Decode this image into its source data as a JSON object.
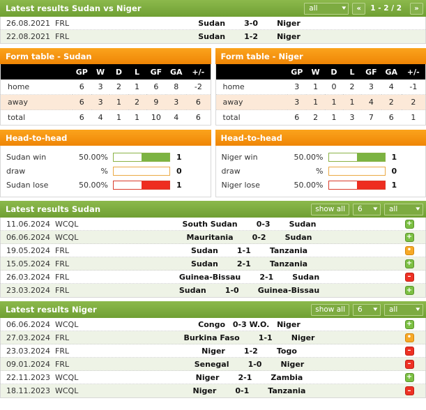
{
  "h2h_results": {
    "header": {
      "title": "Latest results Sudan vs Niger",
      "filter_value": "all",
      "prev_label": "«",
      "next_label": "»",
      "pagination": "1 - 2 / 2"
    },
    "rows": [
      {
        "date": "26.08.2021",
        "competition": "FRL",
        "home": "Sudan",
        "score": "3-0",
        "away": "Niger"
      },
      {
        "date": "22.08.2021",
        "competition": "FRL",
        "home": "Sudan",
        "score": "1-2",
        "away": "Niger"
      }
    ]
  },
  "form_tables": [
    {
      "title": "Form table - Sudan",
      "columns": [
        "",
        "GP",
        "W",
        "D",
        "L",
        "GF",
        "GA",
        "+/-"
      ],
      "rows": [
        {
          "label": "home",
          "gp": "6",
          "w": "3",
          "d": "2",
          "l": "1",
          "gf": "6",
          "ga": "8",
          "diff": "-2"
        },
        {
          "label": "away",
          "gp": "6",
          "w": "3",
          "d": "1",
          "l": "2",
          "gf": "9",
          "ga": "3",
          "diff": "6"
        },
        {
          "label": "total",
          "gp": "6",
          "w": "4",
          "d": "1",
          "l": "1",
          "gf": "10",
          "ga": "4",
          "diff": "6"
        }
      ]
    },
    {
      "title": "Form table - Niger",
      "columns": [
        "",
        "GP",
        "W",
        "D",
        "L",
        "GF",
        "GA",
        "+/-"
      ],
      "rows": [
        {
          "label": "home",
          "gp": "3",
          "w": "1",
          "d": "0",
          "l": "2",
          "gf": "3",
          "ga": "4",
          "diff": "-1"
        },
        {
          "label": "away",
          "gp": "3",
          "w": "1",
          "d": "1",
          "l": "1",
          "gf": "4",
          "ga": "2",
          "diff": "2"
        },
        {
          "label": "total",
          "gp": "6",
          "w": "2",
          "d": "1",
          "l": "3",
          "gf": "7",
          "ga": "6",
          "diff": "1"
        }
      ]
    }
  ],
  "head_to_head": [
    {
      "title": "Head-to-head",
      "rows": [
        {
          "label": "Sudan win",
          "pct": "50.00%",
          "count": "1",
          "fill": 50,
          "color": "green"
        },
        {
          "label": "draw",
          "pct": "%",
          "count": "0",
          "fill": 0,
          "color": "orange"
        },
        {
          "label": "Sudan lose",
          "pct": "50.00%",
          "count": "1",
          "fill": 50,
          "color": "red"
        }
      ]
    },
    {
      "title": "Head-to-head",
      "rows": [
        {
          "label": "Niger win",
          "pct": "50.00%",
          "count": "1",
          "fill": 50,
          "color": "green"
        },
        {
          "label": "draw",
          "pct": "%",
          "count": "0",
          "fill": 0,
          "color": "orange"
        },
        {
          "label": "Niger lose",
          "pct": "50.00%",
          "count": "1",
          "fill": 50,
          "color": "red"
        }
      ]
    }
  ],
  "latest_results": [
    {
      "header": {
        "title": "Latest results Sudan",
        "show_all_label": "show all",
        "count_value": "6",
        "filter_value": "all"
      },
      "rows": [
        {
          "date": "11.06.2024",
          "competition": "WCQL",
          "home": "South Sudan",
          "score": "0-3",
          "away": "Sudan",
          "outcome": "win",
          "icon": "plus-badge-icon",
          "symbol": "+"
        },
        {
          "date": "06.06.2024",
          "competition": "WCQL",
          "home": "Mauritania",
          "score": "0-2",
          "away": "Sudan",
          "outcome": "win",
          "icon": "plus-badge-icon",
          "symbol": "+"
        },
        {
          "date": "19.05.2024",
          "competition": "FRL",
          "home": "Sudan",
          "score": "1-1",
          "away": "Tanzania",
          "outcome": "draw",
          "icon": "dot-badge-icon",
          "symbol": "•"
        },
        {
          "date": "15.05.2024",
          "competition": "FRL",
          "home": "Sudan",
          "score": "2-1",
          "away": "Tanzania",
          "outcome": "win",
          "icon": "plus-badge-icon",
          "symbol": "+"
        },
        {
          "date": "26.03.2024",
          "competition": "FRL",
          "home": "Guinea-Bissau",
          "score": "2-1",
          "away": "Sudan",
          "outcome": "lose",
          "icon": "minus-badge-icon",
          "symbol": "–"
        },
        {
          "date": "23.03.2024",
          "competition": "FRL",
          "home": "Sudan",
          "score": "1-0",
          "away": "Guinea-Bissau",
          "outcome": "win",
          "icon": "plus-badge-icon",
          "symbol": "+"
        }
      ]
    },
    {
      "header": {
        "title": "Latest results Niger",
        "show_all_label": "show all",
        "count_value": "6",
        "filter_value": "all"
      },
      "rows": [
        {
          "date": "06.06.2024",
          "competition": "WCQL",
          "home": "Congo",
          "score": "0-3 W.O.",
          "away": "Niger",
          "outcome": "win",
          "icon": "plus-badge-icon",
          "symbol": "+"
        },
        {
          "date": "27.03.2024",
          "competition": "FRL",
          "home": "Burkina Faso",
          "score": "1-1",
          "away": "Niger",
          "outcome": "draw",
          "icon": "dot-badge-icon",
          "symbol": "•"
        },
        {
          "date": "23.03.2024",
          "competition": "FRL",
          "home": "Niger",
          "score": "1-2",
          "away": "Togo",
          "outcome": "lose",
          "icon": "minus-badge-icon",
          "symbol": "–"
        },
        {
          "date": "09.01.2024",
          "competition": "FRL",
          "home": "Senegal",
          "score": "1-0",
          "away": "Niger",
          "outcome": "lose",
          "icon": "minus-badge-icon",
          "symbol": "–"
        },
        {
          "date": "22.11.2023",
          "competition": "WCQL",
          "home": "Niger",
          "score": "2-1",
          "away": "Zambia",
          "outcome": "win",
          "icon": "plus-badge-icon",
          "symbol": "+"
        },
        {
          "date": "18.11.2023",
          "competition": "WCQL",
          "home": "Niger",
          "score": "0-1",
          "away": "Tanzania",
          "outcome": "lose",
          "icon": "minus-badge-icon",
          "symbol": "–"
        }
      ]
    }
  ],
  "colors": {
    "header_green": "#7cab3f",
    "header_orange": "#f5900c",
    "row_alt": "#eef3e6",
    "form_row_tint": "#fce9d8",
    "win": "#7cc043",
    "draw": "#f7a928",
    "lose": "#ee3124"
  }
}
